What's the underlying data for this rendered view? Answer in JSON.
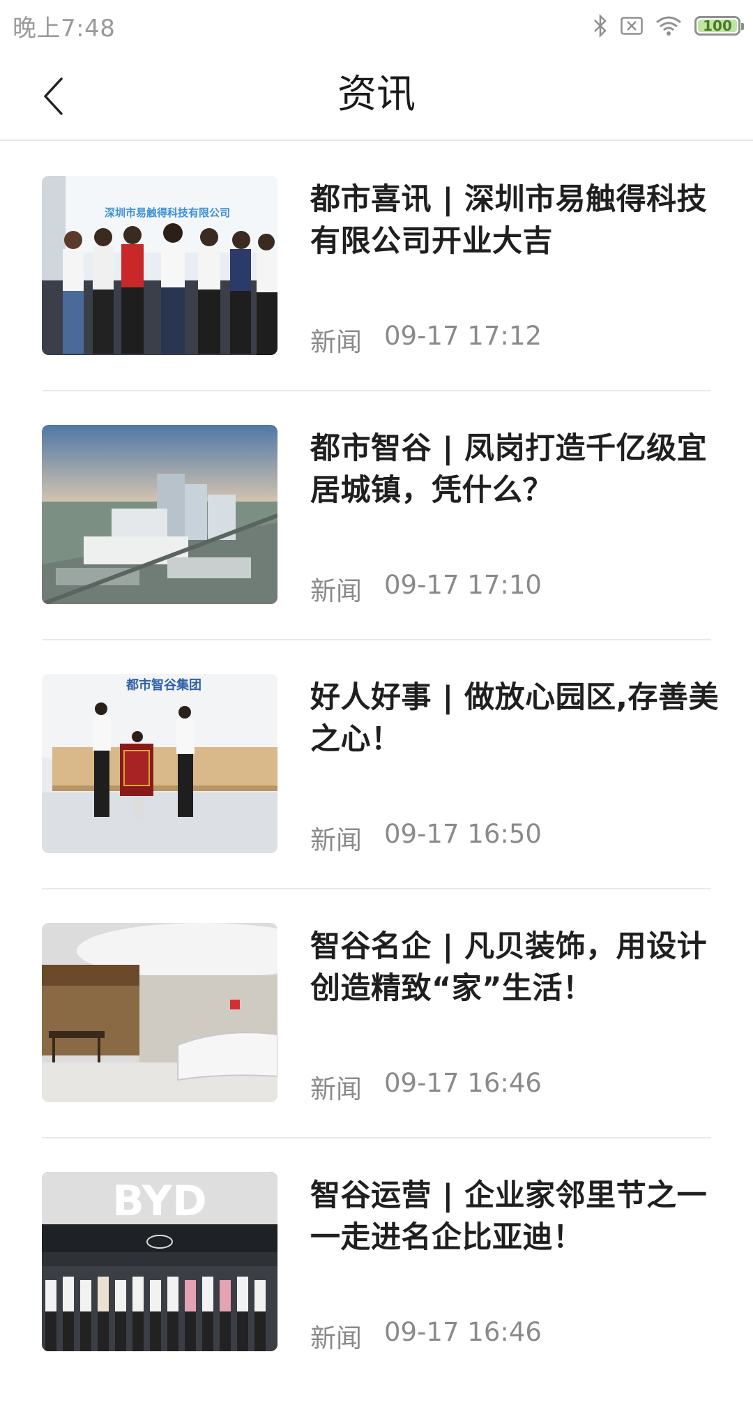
{
  "status_bar": {
    "time": "晚上7:48",
    "battery": "100",
    "icons": [
      "bluetooth-icon",
      "sim-blocked-icon",
      "wifi-icon",
      "battery-icon"
    ]
  },
  "nav": {
    "title": "资讯",
    "back_icon": "chevron-left-icon"
  },
  "articles": [
    {
      "title": "都市喜讯 | 深圳市易触得科技有限公司开业大吉",
      "category": "新闻",
      "time": "09-17 17:12",
      "thumb_text": "深圳市易触得科技有限公司"
    },
    {
      "title": "都市智谷 | 凤岗打造千亿级宜居城镇，凭什么？",
      "category": "新闻",
      "time": "09-17 17:10"
    },
    {
      "title": "好人好事 | 做放心园区,存善美之心！",
      "category": "新闻",
      "time": "09-17 16:50",
      "thumb_text": "都市智谷集团"
    },
    {
      "title": "智谷名企 | 凡贝装饰，用设计创造精致“家”生活！",
      "category": "新闻",
      "time": "09-17 16:46"
    },
    {
      "title": "智谷运营 | 企业家邻里节之一一走进名企比亚迪！",
      "category": "新闻",
      "time": "09-17 16:46",
      "thumb_text": "BYD"
    }
  ]
}
